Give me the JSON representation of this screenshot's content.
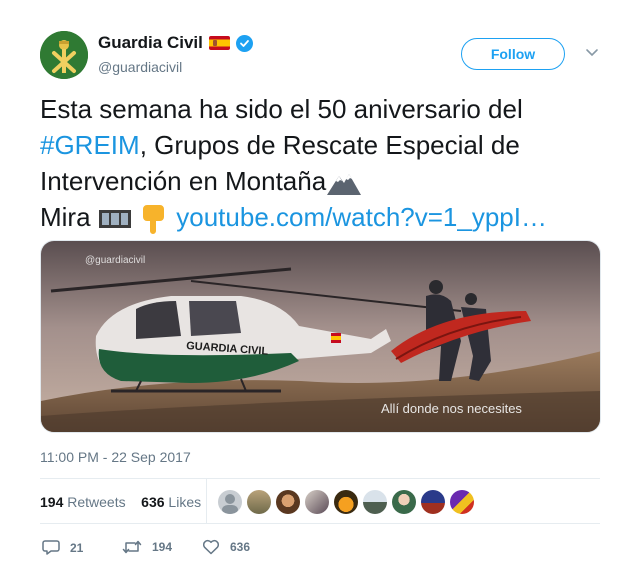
{
  "tweet": {
    "author": {
      "name": "Guardia Civil",
      "handle": "@guardiacivil",
      "flag_icon": "spain-flag-icon",
      "verified_icon": "verified-badge-icon"
    },
    "follow_label": "Follow",
    "text": {
      "line1": "Esta semana ha sido el 50 aniversario del",
      "hashtag": "#GREIM",
      "line2_rest": ", Grupos de Rescate Especial de",
      "line3": "Intervención en Montaña",
      "line4_prefix": "Mira",
      "link": "youtube.com/watch?v=1_yppI…"
    },
    "media": {
      "watermark": "@guardiacivil",
      "caption": "Allí donde nos necesites",
      "helicopter_label": "GUARDIA CIVIL"
    },
    "timestamp": "11:00 PM - 22 Sep 2017",
    "stats": {
      "retweets_count": "194",
      "retweets_label": "Retweets",
      "likes_count": "636",
      "likes_label": "Likes"
    },
    "actions": {
      "replies": "21",
      "retweets": "194",
      "likes": "636"
    }
  },
  "colors": {
    "link": "#1b95e0",
    "follow_border": "#1da1f2",
    "muted": "#657786"
  }
}
